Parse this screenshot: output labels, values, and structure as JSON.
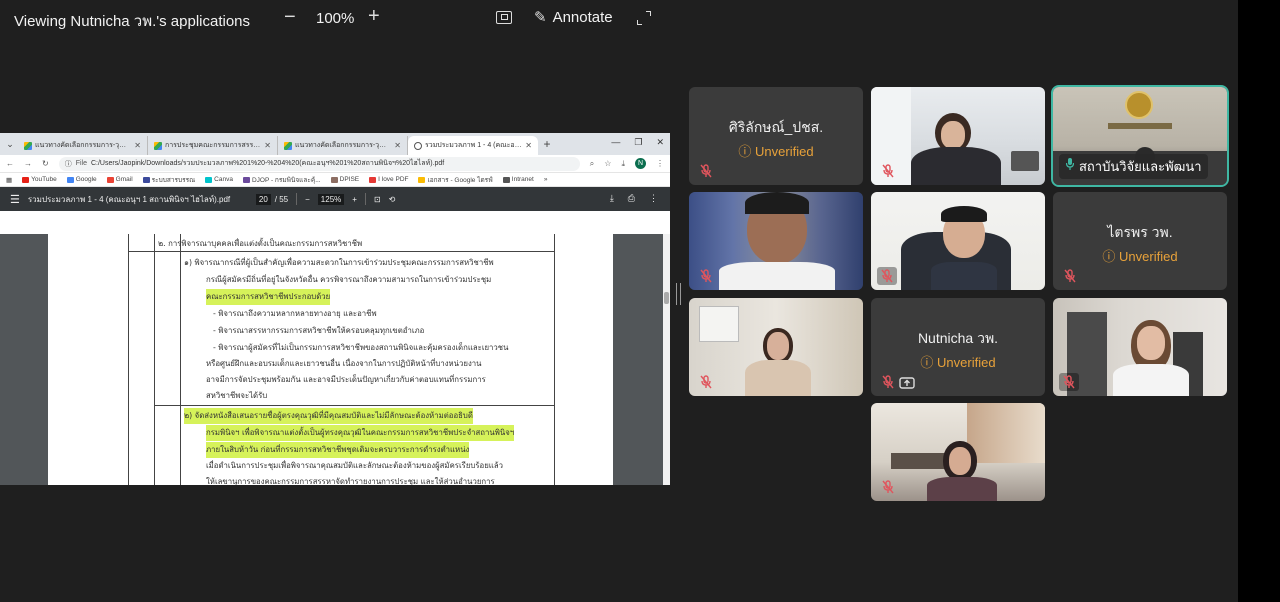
{
  "topbar": {
    "title": "Viewing Nutnicha วพ.'s applications",
    "zoom_minus": "−",
    "zoom_level": "100%",
    "zoom_plus": "+",
    "annotate_label": "Annotate"
  },
  "shared_screen": {
    "tabs": [
      {
        "title": "แนวทางคัดเลือกกรรมการ-วุฒิสภาฯ",
        "icon": "drive"
      },
      {
        "title": "การประชุมคณะกรรมการสรรหา ฯ",
        "icon": "drive"
      },
      {
        "title": "แนวทางคัดเลือกกรรมการ-วุฒิสภาฯ",
        "icon": "drive"
      },
      {
        "title": "รวมประมวลภาพ 1 - 4 (คณะอนุฯ",
        "icon": "globe"
      }
    ],
    "address_prefix": "File",
    "address_url": "C:/Users/Jaopink/Downloads/รวมประมวลภาพ%201%20-%204%20(คณะอนุฯ%201%20สถานพินิจฯ%20ไฮไลท์).pdf",
    "profile_initial": "N",
    "bookmarks": [
      "YouTube",
      "Google",
      "Gmail",
      "ระบบสารบรรณ",
      "Canva",
      "DJOP - กรมพินิจและคุ้...",
      "DPISE",
      "I love PDF",
      "เอกสาร - Google ไดรฟ์",
      "Intranet"
    ],
    "pdf": {
      "title": "รวมประมวลภาพ 1 - 4 (คณะอนุฯ 1 สถานพินิจฯ ไฮไลท์).pdf",
      "page_current": "20",
      "page_total": "/ 55",
      "zoom": "125%",
      "lines": [
        {
          "text": "๒.   การพิจารณาบุคคลเพื่อแต่งตั้งเป็นคณะกรรมการสหวิชาชีพ",
          "hl": false
        },
        {
          "text": "๑)  พิจารณากรณีที่ผู้เป็นสำคัญเพื่อความสะดวกในการเข้าร่วมประชุมคณะกรรมการสหวิชาชีพ",
          "hl": false
        },
        {
          "text": "กรณีผู้สมัครมีถิ่นที่อยู่ในจังหวัดอื่น ควรพิจารณาถึงความสามารถในการเข้าร่วมประชุม",
          "hl": false
        },
        {
          "text": "คณะกรรมการสหวิชาชีพประกอบด้วย",
          "hl": true
        },
        {
          "text": "- พิจารณาถึงความหลากหลายทางอายุ และอาชีพ",
          "hl": false
        },
        {
          "text": "- พิจารณาสรรหากรรมการสหวิชาชีพให้ครอบคลุมทุกเขตอำเภอ",
          "hl": false
        },
        {
          "text": "- พิจารณาผู้สมัครที่ไม่เป็นกรรมการสหวิชาชีพของสถานพินิจและคุ้มครองเด็กและเยาวชน",
          "hl": false
        },
        {
          "text": "หรือศูนย์ฝึกและอบรมเด็กและเยาวชนอื่น เนื่องจากในการปฏิบัติหน้าที่บางหน่วยงาน",
          "hl": false
        },
        {
          "text": "อาจมีการจัดประชุมพร้อมกัน และอาจมีประเด็นปัญหาเกี่ยวกับค่าตอบแทนที่กรรมการ",
          "hl": false
        },
        {
          "text": "สหวิชาชีพจะได้รับ",
          "hl": false
        },
        {
          "text": "๒)  จัดส่งหนังสือเสนอรายชื่อผู้ตรงคุณวุฒิที่มีคุณสมบัติและไม่มีลักษณะต้องห้ามต่ออธิบดี",
          "hl": true
        },
        {
          "text": "กรมพินิจฯ เพื่อพิจารณาแต่งตั้งเป็นผู้ทรงคุณวุฒิในคณะกรรมการสหวิชาชีพประจำสถานพินิจฯ",
          "hl": true
        },
        {
          "text": "ภายในสิบห้าวัน ก่อนที่กรรมการสหวิชาชีพชุดเดิมจะครบวาระการดำรงตำแหน่ง",
          "hl": true
        },
        {
          "text": "เมื่อดำเนินการประชุมเพื่อพิจารณาคุณสมบัติและลักษณะต้องห้ามของผู้สมัครเรียบร้อยแล้ว",
          "hl": false
        },
        {
          "text": "ให้เลขานุการของคณะกรรมการสรรหาจัดทำรายงานการประชุม และให้ส่วนอำนวยการ",
          "hl": false
        }
      ]
    }
  },
  "participants": [
    {
      "name": "ศิริลักษณ์_ปชส.",
      "status": "Unverified",
      "video": false
    },
    {
      "name": "",
      "status": "",
      "video": true
    },
    {
      "name": "สถาบันวิจัยและพัฒนา",
      "status": "",
      "video": true,
      "speaking": true
    },
    {
      "name": "",
      "status": "",
      "video": true
    },
    {
      "name": "",
      "status": "",
      "video": true
    },
    {
      "name": "ไตรพร วพ.",
      "status": "Unverified",
      "video": false
    },
    {
      "name": "",
      "status": "",
      "video": true
    },
    {
      "name": "Nutnicha วพ.",
      "status": "Unverified",
      "video": false,
      "sharing": true
    },
    {
      "name": "",
      "status": "",
      "video": true
    },
    {
      "name": "",
      "status": "",
      "video": true
    }
  ],
  "colors": {
    "background": "#1f1f1f",
    "tile": "#3b3b3b",
    "unverified": "#e8a23a",
    "speaking_border": "#3fb7a3",
    "highlight": "#d6f25a",
    "mic_off": "#e0555d"
  }
}
